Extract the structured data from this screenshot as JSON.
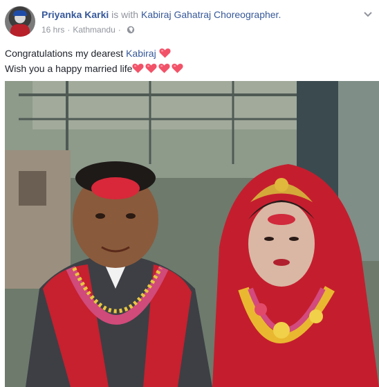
{
  "post": {
    "author": "Priyanka Karki",
    "with_text": " is with ",
    "tagged_person": "Kabiraj Gahatraj Choreographer.",
    "time": "16 hrs",
    "separator": "·",
    "location": "Kathmandu",
    "privacy_icon": "globe-icon",
    "menu_icon": "chevron-down-icon",
    "message_line1_prefix": "Congratulations my dearest ",
    "message_mention": "Kabiraj",
    "message_line2": "Wish you a happy married life",
    "heart_emoji": "heart-emoji",
    "accent_color": "#365899",
    "muted_color": "#90949c",
    "heart_color": "#f25268"
  }
}
